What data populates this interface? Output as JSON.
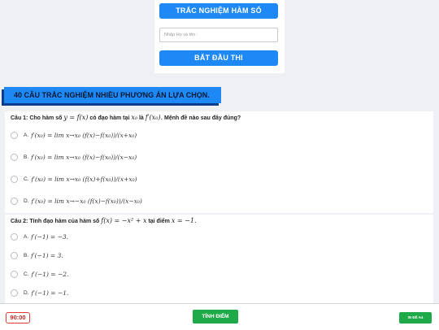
{
  "header": {
    "title_button": "TRẮC NGHIỆM HÀM SỐ",
    "name_placeholder": "Nhập Họ và tên :",
    "start_button": "BẮT ĐẦU THI"
  },
  "section_title": "40 CÂU TRẮC NGHIỆM NHIỀU PHƯƠNG ÁN LỰA CHỌN.",
  "questions": [
    {
      "stem_prefix": "Câu 1: Cho hàm số",
      "stem_math1": "y = f(x)",
      "stem_mid": "có đạo hàm tại",
      "stem_math2": "x₀",
      "stem_mid2": "là",
      "stem_math3": "f′(x₀).",
      "stem_suffix": "Mệnh đề nào sau đây đúng?",
      "options": [
        {
          "letter": "A.",
          "math": "f′(x₀) = lim x→x₀ (f(x)−f(x₀))/(x+x₀)"
        },
        {
          "letter": "B.",
          "math": "f′(x₀) = lim x→x₀ (f(x)−f(x₀))/(x−x₀)"
        },
        {
          "letter": "C.",
          "math": "f′(x₀) = lim x→x₀ (f(x)+f(x₀))/(x+x₀)"
        },
        {
          "letter": "D.",
          "math": "f′(x₀) = lim x→−x₀ (f(x)−f(x₀))/(x−x₀)"
        }
      ]
    },
    {
      "stem_prefix": "Câu 2: Tính đạo hàm của hàm số",
      "stem_math1": "f(x) = −x² + x",
      "stem_mid": "tại điểm",
      "stem_math2": "x = −1.",
      "options": [
        {
          "letter": "A.",
          "math": "f′(−1) = −3."
        },
        {
          "letter": "B.",
          "math": "f′(−1) = 3."
        },
        {
          "letter": "C.",
          "math": "f′(−1) = −2."
        },
        {
          "letter": "D.",
          "math": "f′(−1) = −1."
        }
      ]
    }
  ],
  "footer": {
    "timer": "90:00",
    "score_button": "TÍNH ĐIỂM",
    "print_button": "IN ĐỀ A4"
  },
  "colors": {
    "primary_blue": "#1e88f5",
    "green": "#1faa4a",
    "timer_red": "#e53935"
  }
}
